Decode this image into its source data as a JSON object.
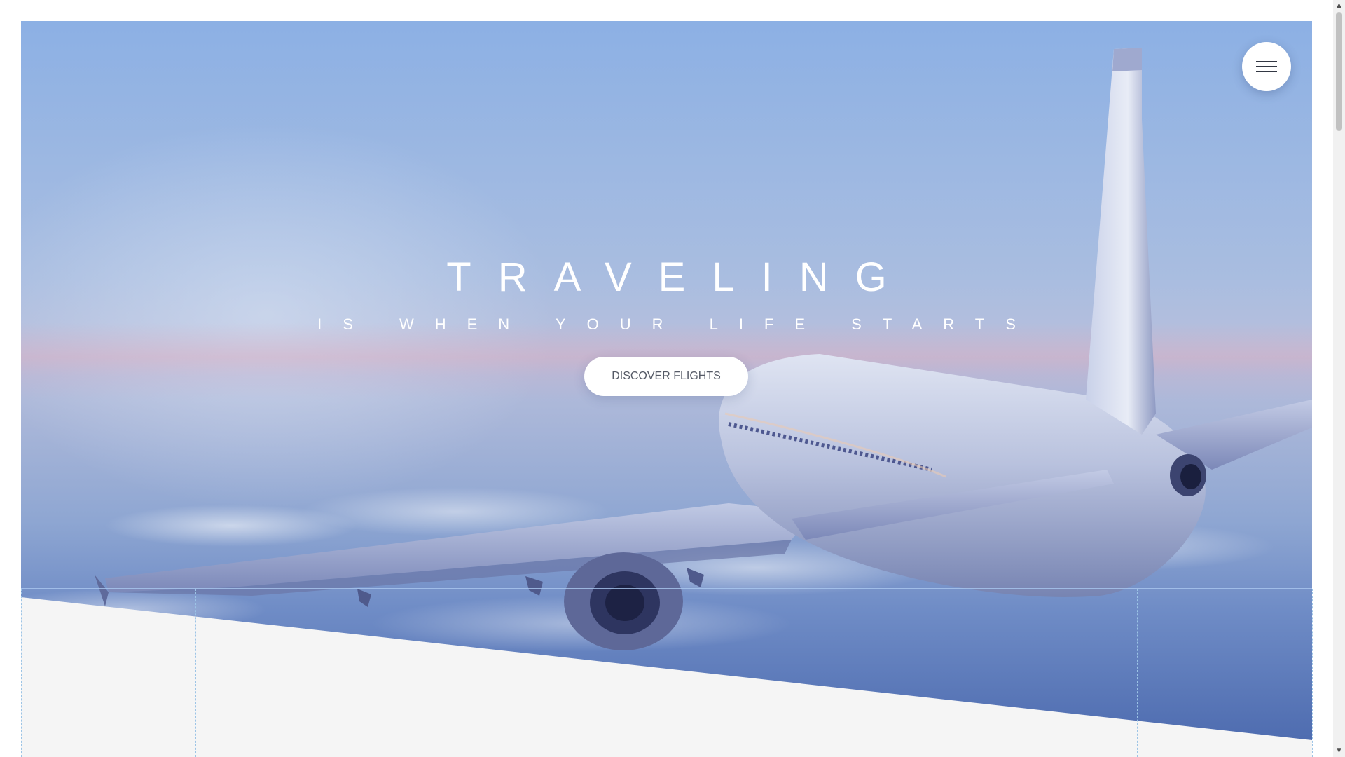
{
  "hero": {
    "title": "TRAVELING",
    "subtitle": "IS WHEN YOUR LIFE STARTS",
    "cta_label": "DISCOVER FLIGHTS"
  },
  "menu": {
    "icon": "hamburger-icon"
  },
  "scrollbar": {
    "up_arrow": "▲",
    "down_arrow": "▼"
  },
  "colors": {
    "sky_top": "#8cb0e4",
    "sky_bottom": "#4a68ad",
    "section_bg": "#f5f5f5",
    "guide_line": "#9cc4e6",
    "button_bg": "#ffffff",
    "button_text": "#555a66"
  }
}
